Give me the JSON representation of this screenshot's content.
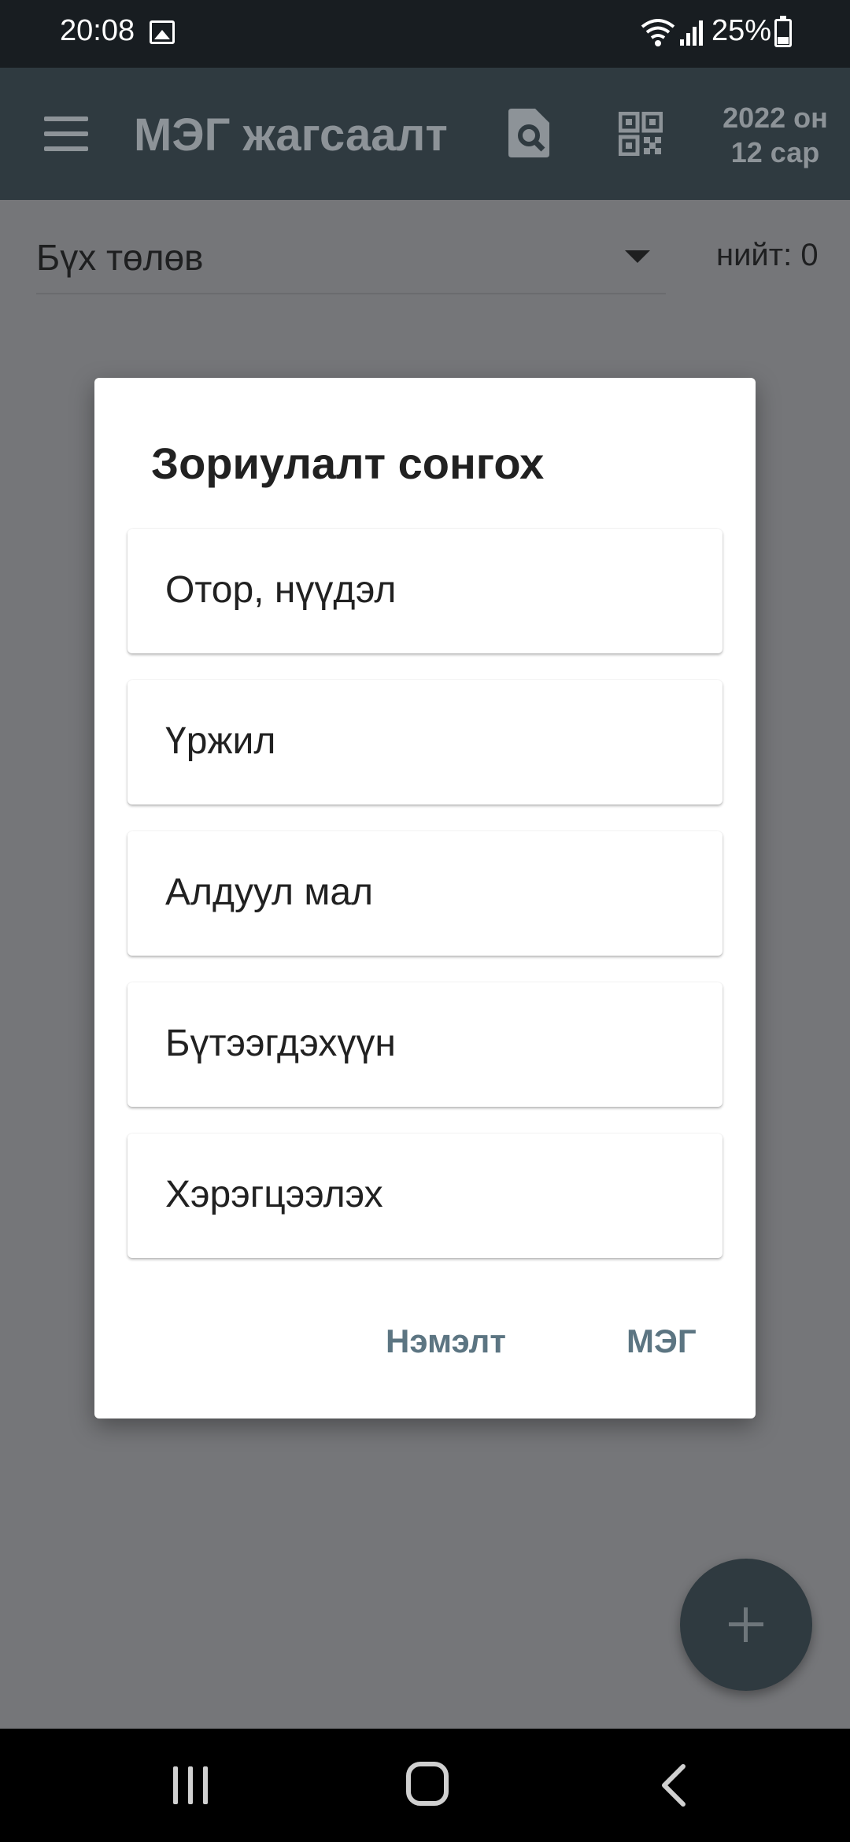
{
  "status_bar": {
    "time": "20:08",
    "battery_percent": "25%",
    "icons": [
      "gallery-icon",
      "wifi-icon",
      "signal-icon",
      "battery-icon"
    ]
  },
  "app_bar": {
    "title": "МЭГ жагсаалт",
    "period_year": "2022 он",
    "period_month": "12 сар",
    "icons": [
      "menu-icon",
      "document-search-icon",
      "qr-code-icon"
    ]
  },
  "filter": {
    "selected": "Бүх төлөв",
    "total": "нийт: 0"
  },
  "dialog": {
    "title": "Зориулалт сонгох",
    "options": [
      {
        "label": "Отор, нүүдэл"
      },
      {
        "label": "Үржил"
      },
      {
        "label": "Алдуул мал"
      },
      {
        "label": "Бүтээгдэхүүн"
      },
      {
        "label": "Хэрэгцээлэх"
      }
    ],
    "buttons": {
      "extra": "Нэмэлт",
      "meg": "МЭГ"
    }
  },
  "colors": {
    "app_bar": "#2f3a40",
    "scrim": "#757679",
    "dialog_button": "#5c7582"
  }
}
